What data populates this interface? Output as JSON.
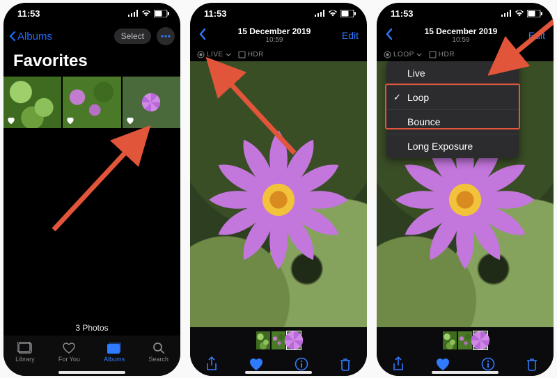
{
  "status": {
    "time": "11:53"
  },
  "screen1": {
    "back_label": "Albums",
    "select_label": "Select",
    "title": "Favorites",
    "photos_count": "3 Photos",
    "tabs": {
      "library": "Library",
      "foryou": "For You",
      "albums": "Albums",
      "search": "Search"
    }
  },
  "screen2": {
    "date": "15 December 2019",
    "time": "10:59",
    "edit": "Edit",
    "live_badge": "LIVE",
    "hdr_badge": "HDR"
  },
  "screen3": {
    "date": "15 December 2019",
    "time": "10:59",
    "edit": "Edit",
    "loop_badge": "LOOP",
    "hdr_badge": "HDR",
    "menu": {
      "live": "Live",
      "loop": "Loop",
      "bounce": "Bounce",
      "long_exposure": "Long Exposure"
    }
  }
}
